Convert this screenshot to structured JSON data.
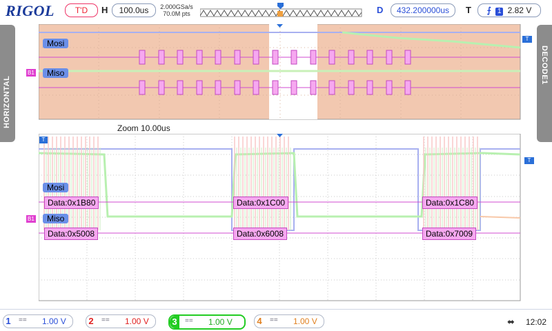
{
  "brand": "RIGOL",
  "status": {
    "trig_state": "T'D",
    "h_label": "H",
    "timebase": "100.0us",
    "sample_rate": "2.000GSa/s",
    "mem_depth": "70.0M pts",
    "d_label": "D",
    "delay": "432.200000us",
    "t_label": "T",
    "trigger_source": "1",
    "trigger_level": "2.82 V"
  },
  "side_tabs": {
    "left": "HORIZONTAL",
    "right": "DECODE1"
  },
  "zoom_label": "Zoom  10.00us",
  "bus": {
    "mosi": "Mosi",
    "miso": "Miso",
    "marker": "B1",
    "trig_marker": "T"
  },
  "decode": {
    "mosi": [
      "Data:0x1B80",
      "Data:0x1C00",
      "Data:0x1C80"
    ],
    "miso": [
      "Data:0x5008",
      "Data:0x6008",
      "Data:0x7009"
    ]
  },
  "channels": [
    {
      "num": "1",
      "coupling": "==",
      "value": "1.00 V",
      "color": "#2a4fd8"
    },
    {
      "num": "2",
      "coupling": "==",
      "value": "1.00 V",
      "color": "#e02020"
    },
    {
      "num": "3",
      "coupling": "==",
      "value": "1.00 V",
      "color": "#22cc22"
    },
    {
      "num": "4",
      "coupling": "==",
      "value": "1.00 V",
      "color": "#e08020"
    }
  ],
  "clock": "12:02",
  "colors": {
    "accent": "#1a3a9a",
    "bus": "#d04bd0",
    "decode_fill": "#f6a8f0",
    "overview_bg": "#f2c8b0"
  }
}
